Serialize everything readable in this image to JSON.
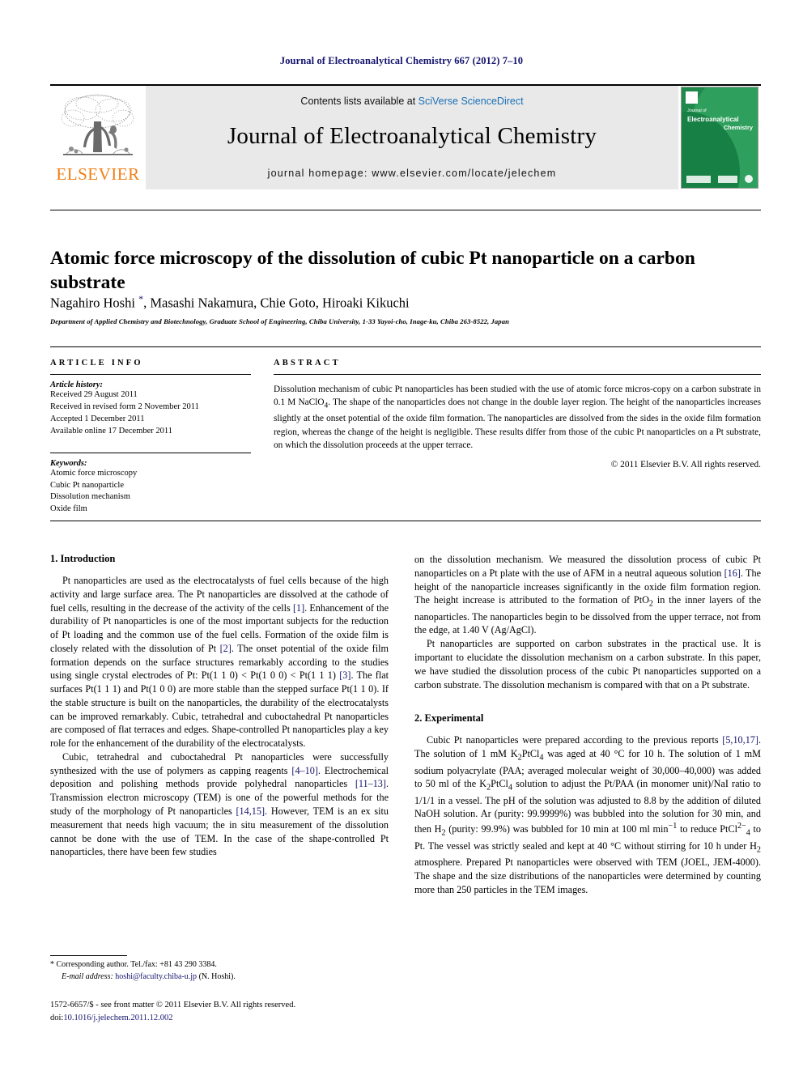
{
  "running_head": "Journal of Electroanalytical Chemistry 667 (2012) 7–10",
  "masthead": {
    "publisher_name": "ELSEVIER",
    "contents_prefix": "Contents lists available at ",
    "contents_link": "SciVerse ScienceDirect",
    "journal_title": "Journal of Electroanalytical Chemistry",
    "homepage_line": "journal homepage: www.elsevier.com/locate/jelechem",
    "cover": {
      "line1": "Journal of",
      "line2": "Electroanalytical",
      "line3": "Chemistry"
    }
  },
  "article": {
    "title": "Atomic force microscopy of the dissolution of cubic Pt nanoparticle on a carbon substrate",
    "authors": "Nagahiro Hoshi ",
    "author_star": "*",
    "authors_rest": ", Masashi Nakamura, Chie Goto, Hiroaki Kikuchi",
    "affiliation": "Department of Applied Chemistry and Biotechnology, Graduate School of Engineering, Chiba University, 1-33 Yayoi-cho, Inage-ku, Chiba 263-8522, Japan"
  },
  "article_info": {
    "heading": "ARTICLE INFO",
    "history_label": "Article history:",
    "history": [
      "Received 29 August 2011",
      "Received in revised form 2 November 2011",
      "Accepted 1 December 2011",
      "Available online 17 December 2011"
    ],
    "keywords_label": "Keywords:",
    "keywords": [
      "Atomic force microscopy",
      "Cubic Pt nanoparticle",
      "Dissolution mechanism",
      "Oxide film"
    ]
  },
  "abstract": {
    "heading": "ABSTRACT",
    "text_part1": "Dissolution mechanism of cubic Pt nanoparticles has been studied with the use of atomic force micros-copy on a carbon substrate in 0.1 M NaClO",
    "text_sub1": "4",
    "text_part2": ". The shape of the nanoparticles does not change in the double layer region. The height of the nanoparticles increases slightly at the onset potential of the oxide film formation. The nanoparticles are dissolved from the sides in the oxide film formation region, whereas the change of the height is negligible. These results differ from those of the cubic Pt nanoparticles on a Pt substrate, on which the dissolution proceeds at the upper terrace.",
    "copyright": "© 2011 Elsevier B.V. All rights reserved."
  },
  "sections": {
    "introduction_heading": "1. Introduction",
    "experimental_heading": "2. Experimental"
  },
  "body": {
    "intro_p1_a": "Pt nanoparticles are used as the electrocatalysts of fuel cells because of the high activity and large surface area. The Pt nanoparticles are dissolved at the cathode of fuel cells, resulting in the decrease of the activity of the cells ",
    "intro_p1_r1": "[1]",
    "intro_p1_b": ". Enhancement of the durability of Pt nanoparticles is one of the most important subjects for the reduction of Pt loading and the common use of the fuel cells. Formation of the oxide film is closely related with the dissolution of Pt ",
    "intro_p1_r2": "[2]",
    "intro_p1_c": ". The onset potential of the oxide film formation depends on the surface structures remarkably according to the studies using single crystal electrodes of Pt: Pt(1 1 0) < Pt(1 0 0) < Pt(1 1 1) ",
    "intro_p1_r3": "[3]",
    "intro_p1_d": ". The flat surfaces Pt(1 1 1) and Pt(1 0 0) are more stable than the stepped surface Pt(1 1 0). If the stable structure is built on the nanoparticles, the durability of the electrocatalysts can be improved remarkably. Cubic, tetrahedral and cuboctahedral Pt nanoparticles are composed of flat terraces and edges. Shape-controlled Pt nanoparticles play a key role for the enhancement of the durability of the electrocatalysts.",
    "intro_p2_a": "Cubic, tetrahedral and cuboctahedral Pt nanoparticles were successfully synthesized with the use of polymers as capping reagents ",
    "intro_p2_r1": "[4–10]",
    "intro_p2_b": ". Electrochemical deposition and polishing methods provide polyhedral nanoparticles ",
    "intro_p2_r2": "[11–13]",
    "intro_p2_c": ". Transmission electron microscopy (TEM) is one of the powerful methods for the study of the morphology of Pt nanoparticles ",
    "intro_p2_r3": "[14,15]",
    "intro_p2_d": ". However, TEM is an ex situ measurement that needs high vacuum; the in situ measurement of the dissolution cannot be done with the use of TEM. In the case of the shape-controlled Pt nanoparticles, there have been few studies",
    "intro_p2_cont_a": "on the dissolution mechanism. We measured the dissolution process of cubic Pt nanoparticles on a Pt plate with the use of AFM in a neutral aqueous solution ",
    "intro_p2_cont_r": "[16]",
    "intro_p2_cont_b": ". The height of the nanoparticle increases significantly in the oxide film formation region. The height increase is attributed to the formation of PtO",
    "intro_p2_cont_sub": "2",
    "intro_p2_cont_c": " in the inner layers of the nanoparticles. The nanoparticles begin to be dissolved from the upper terrace, not from the edge, at 1.40 V (Ag/AgCl).",
    "intro_p3": "Pt nanoparticles are supported on carbon substrates in the practical use. It is important to elucidate the dissolution mechanism on a carbon substrate. In this paper, we have studied the dissolution process of the cubic Pt nanoparticles supported on a carbon substrate. The dissolution mechanism is compared with that on a Pt substrate.",
    "exp_p1_a": "Cubic Pt nanoparticles were prepared according to the previous reports ",
    "exp_p1_r1": "[5,10,17]",
    "exp_p1_b": ". The solution of 1 mM K",
    "exp_p1_sub1": "2",
    "exp_p1_c": "PtCl",
    "exp_p1_sub2": "4",
    "exp_p1_d": " was aged at 40 °C for 10 h. The solution of 1 mM sodium polyacrylate (PAA; averaged molecular weight of 30,000–40,000) was added to 50 ml of the K",
    "exp_p1_sub3": "2",
    "exp_p1_e": "PtCl",
    "exp_p1_sub4": "4",
    "exp_p1_f": " solution to adjust the Pt/PAA (in monomer unit)/NaI ratio to 1/1/1 in a vessel. The pH of the solution was adjusted to 8.8 by the addition of diluted NaOH solution. Ar (purity: 99.9999%) was bubbled into the solution for 30 min, and then H",
    "exp_p1_sub5": "2",
    "exp_p1_g": " (purity: 99.9%) was bubbled for 10 min at 100 ml min",
    "exp_p1_sup1": "−1",
    "exp_p1_h": " to reduce PtCl",
    "exp_p1_sup2": "2−",
    "exp_p1_sub6": "4",
    "exp_p1_i": " to Pt. The vessel was strictly sealed and kept at 40 °C without stirring for 10 h under H",
    "exp_p1_sub7": "2",
    "exp_p1_j": " atmosphere. Prepared Pt nanoparticles were observed with TEM (JOEL, JEM-4000). The shape and the size distributions of the nanoparticles were determined by counting more than 250 particles in the TEM images."
  },
  "footnote": {
    "star": "*",
    "corresponding": "Corresponding author. Tel./fax: +81 43 290 3384.",
    "email_label": "E-mail address:",
    "email": "hoshi@faculty.chiba-u.jp",
    "email_suffix": " (N. Hoshi)."
  },
  "footer": {
    "line1": "1572-6657/$ - see front matter © 2011 Elsevier B.V. All rights reserved.",
    "doi_label": "doi:",
    "doi_value": "10.1016/j.jelechem.2011.12.002"
  },
  "colors": {
    "link": "#1a6fb5",
    "ref": "#14146e",
    "elsevier_orange": "#f07f13",
    "cover_green": "#1f8a4c",
    "band_gray": "#e9e9e9"
  }
}
